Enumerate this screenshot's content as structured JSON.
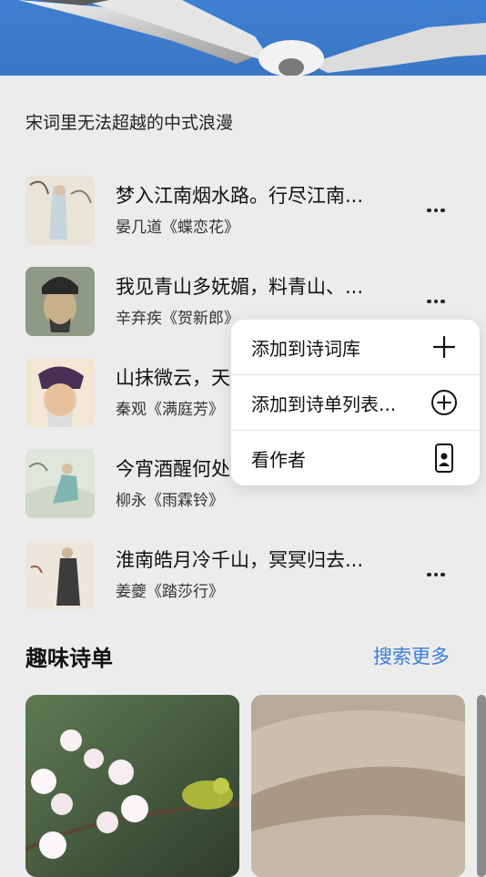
{
  "header": {
    "subtitle": "宋词里无法超越的中式浪漫"
  },
  "poems": [
    {
      "title": "梦入江南烟水路。行尽江南...",
      "author": "晏几道《蝶恋花》"
    },
    {
      "title": "我见青山多妩媚，料青山、...",
      "author": "辛弃疾《贺新郎》"
    },
    {
      "title": "山抹微云，天",
      "author": "秦观《满庭芳》"
    },
    {
      "title": "今宵酒醒何处",
      "author": "柳永《雨霖铃》"
    },
    {
      "title": "淮南皓月冷千山，冥冥归去...",
      "author": "姜夔《踏莎行》"
    }
  ],
  "context_menu": {
    "items": [
      {
        "label": "添加到诗词库",
        "icon": "plus-icon"
      },
      {
        "label": "添加到诗单列表...",
        "icon": "circle-plus-icon"
      },
      {
        "label": "看作者",
        "icon": "person-card-icon"
      }
    ]
  },
  "section": {
    "title": "趣味诗单",
    "action": "搜索更多"
  },
  "colors": {
    "accent": "#3b7ddd",
    "background": "#ececec"
  }
}
